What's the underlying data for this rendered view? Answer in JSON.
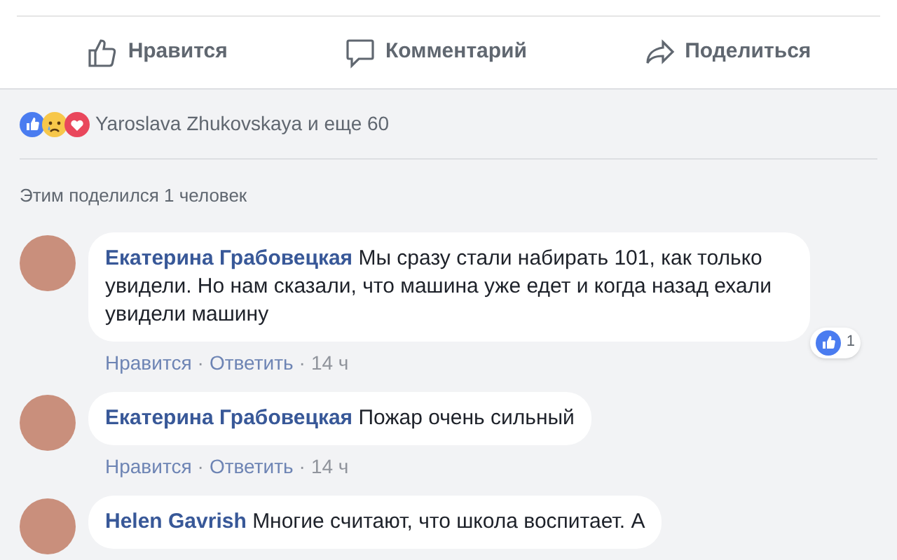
{
  "actions": [
    {
      "kind": "like",
      "label": "Нравится"
    },
    {
      "kind": "comment",
      "label": "Комментарий"
    },
    {
      "kind": "share",
      "label": "Поделиться"
    }
  ],
  "reactions": {
    "types": [
      {
        "kind": "like"
      },
      {
        "kind": "sad"
      },
      {
        "kind": "love"
      }
    ],
    "summary": "Yaroslava Zhukovskaya и еще 60"
  },
  "shares": "Этим поделился 1 человек",
  "comments": [
    {
      "author": "Екатерина Грабовецкая",
      "text": "Мы сразу стали набирать 101, как только увидели. Но нам сказали, что машина уже едет и когда назад ехали увидели машину",
      "like": "Нравится",
      "separator": "·",
      "reply": "Ответить",
      "separator_2": "·",
      "time": "14 ч",
      "reaction_count": "1"
    },
    {
      "author": "Екатерина Грабовецкая",
      "text": "Пожар очень сильный",
      "like": "Нравится",
      "separator": "·",
      "reply": "Ответить",
      "separator_2": "·",
      "time": "14 ч"
    },
    {
      "author": "Helen Gavrish",
      "text": "Многие считают, что школа воспитает. А"
    }
  ]
}
